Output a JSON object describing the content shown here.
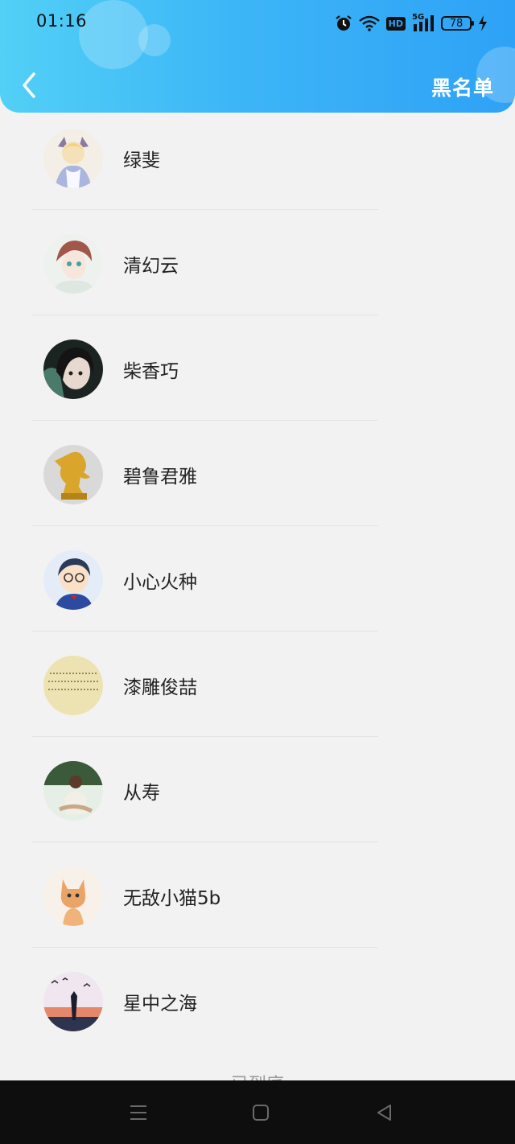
{
  "status_bar": {
    "time": "01:16",
    "network": "5G",
    "hd_label": "HD",
    "battery": "78"
  },
  "header": {
    "title": "黑名单",
    "accent_from": "#52d0f6",
    "accent_to": "#2ea2f6"
  },
  "list": {
    "items": [
      {
        "name": "绿斐"
      },
      {
        "name": "清幻云"
      },
      {
        "name": "柴香巧"
      },
      {
        "name": "碧鲁君雅"
      },
      {
        "name": "小心火种"
      },
      {
        "name": "漆雕俊喆"
      },
      {
        "name": "从寿"
      },
      {
        "name": "无敌小猫5b"
      },
      {
        "name": "星中之海"
      }
    ],
    "end_text": "已到底"
  },
  "icons": {
    "back": "chevron-left-icon",
    "alarm": "alarm-icon",
    "wifi": "wifi-icon",
    "signal": "signal-icon",
    "charging": "charging-icon",
    "nav_menu": "menu-icon",
    "nav_home": "home-icon",
    "nav_back": "back-triangle-icon"
  }
}
